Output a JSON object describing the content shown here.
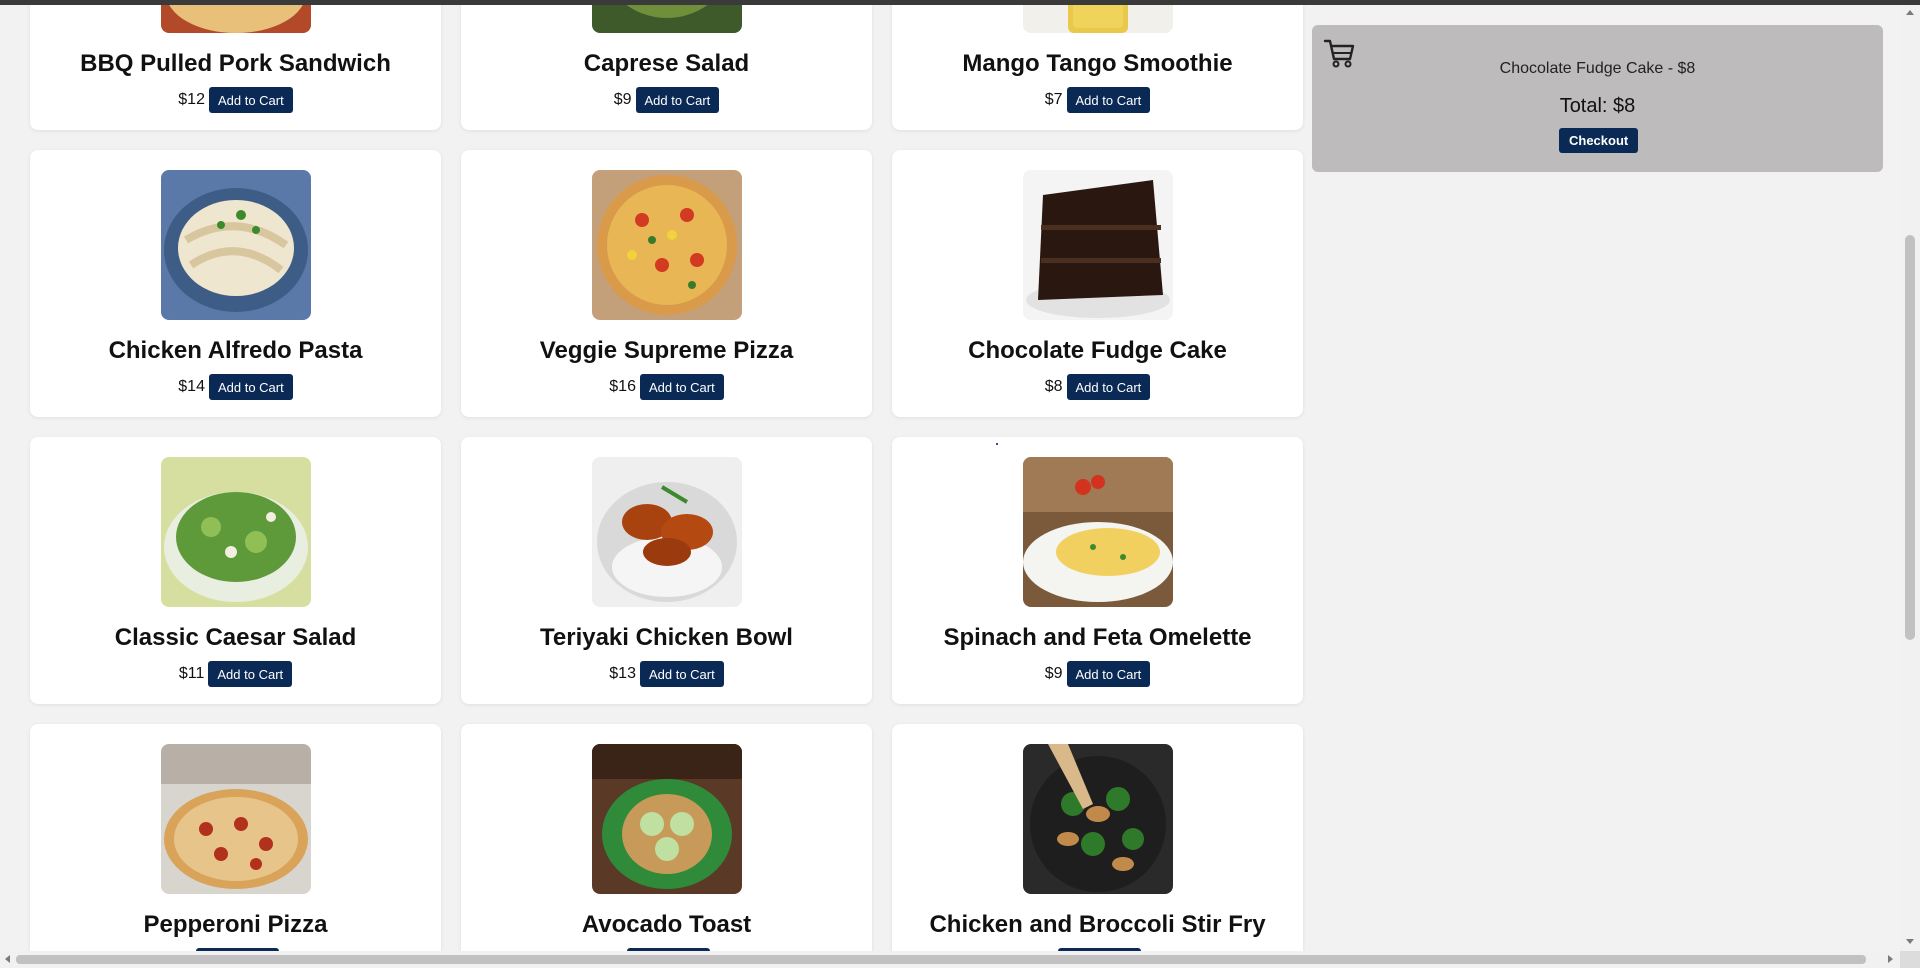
{
  "menu": {
    "add_label": "Add to Cart",
    "items": [
      {
        "name": "BBQ Pulled Pork Sandwich",
        "price": "$12",
        "image": "pulled-pork-sandwich-photo"
      },
      {
        "name": "Caprese Salad",
        "price": "$9",
        "image": "caprese-salad-photo"
      },
      {
        "name": "Mango Tango Smoothie",
        "price": "$7",
        "image": "mango-smoothie-photo"
      },
      {
        "name": "Chicken Alfredo Pasta",
        "price": "$14",
        "image": "alfredo-pasta-photo"
      },
      {
        "name": "Veggie Supreme Pizza",
        "price": "$16",
        "image": "veggie-pizza-photo"
      },
      {
        "name": "Chocolate Fudge Cake",
        "price": "$8",
        "image": "chocolate-cake-photo"
      },
      {
        "name": "Classic Caesar Salad",
        "price": "$11",
        "image": "caesar-salad-photo"
      },
      {
        "name": "Teriyaki Chicken Bowl",
        "price": "$13",
        "image": "teriyaki-bowl-photo"
      },
      {
        "name": "Spinach and Feta Omelette",
        "price": "$9",
        "image": "omelette-photo"
      },
      {
        "name": "Pepperoni Pizza",
        "price": "",
        "image": "pepperoni-pizza-photo"
      },
      {
        "name": "Avocado Toast",
        "price": "",
        "image": "avocado-toast-photo"
      },
      {
        "name": "Chicken and Broccoli Stir Fry",
        "price": "",
        "image": "stir-fry-photo"
      }
    ]
  },
  "cart": {
    "icon": "cart-icon",
    "items": [
      "Chocolate Fudge Cake - $8"
    ],
    "total": "Total: $8",
    "checkout_label": "Checkout"
  },
  "colors": {
    "page_bg": "#f2f2f2",
    "card_bg": "#ffffff",
    "button_bg": "#0a2a55",
    "cart_bg": "#bdbbbb"
  }
}
